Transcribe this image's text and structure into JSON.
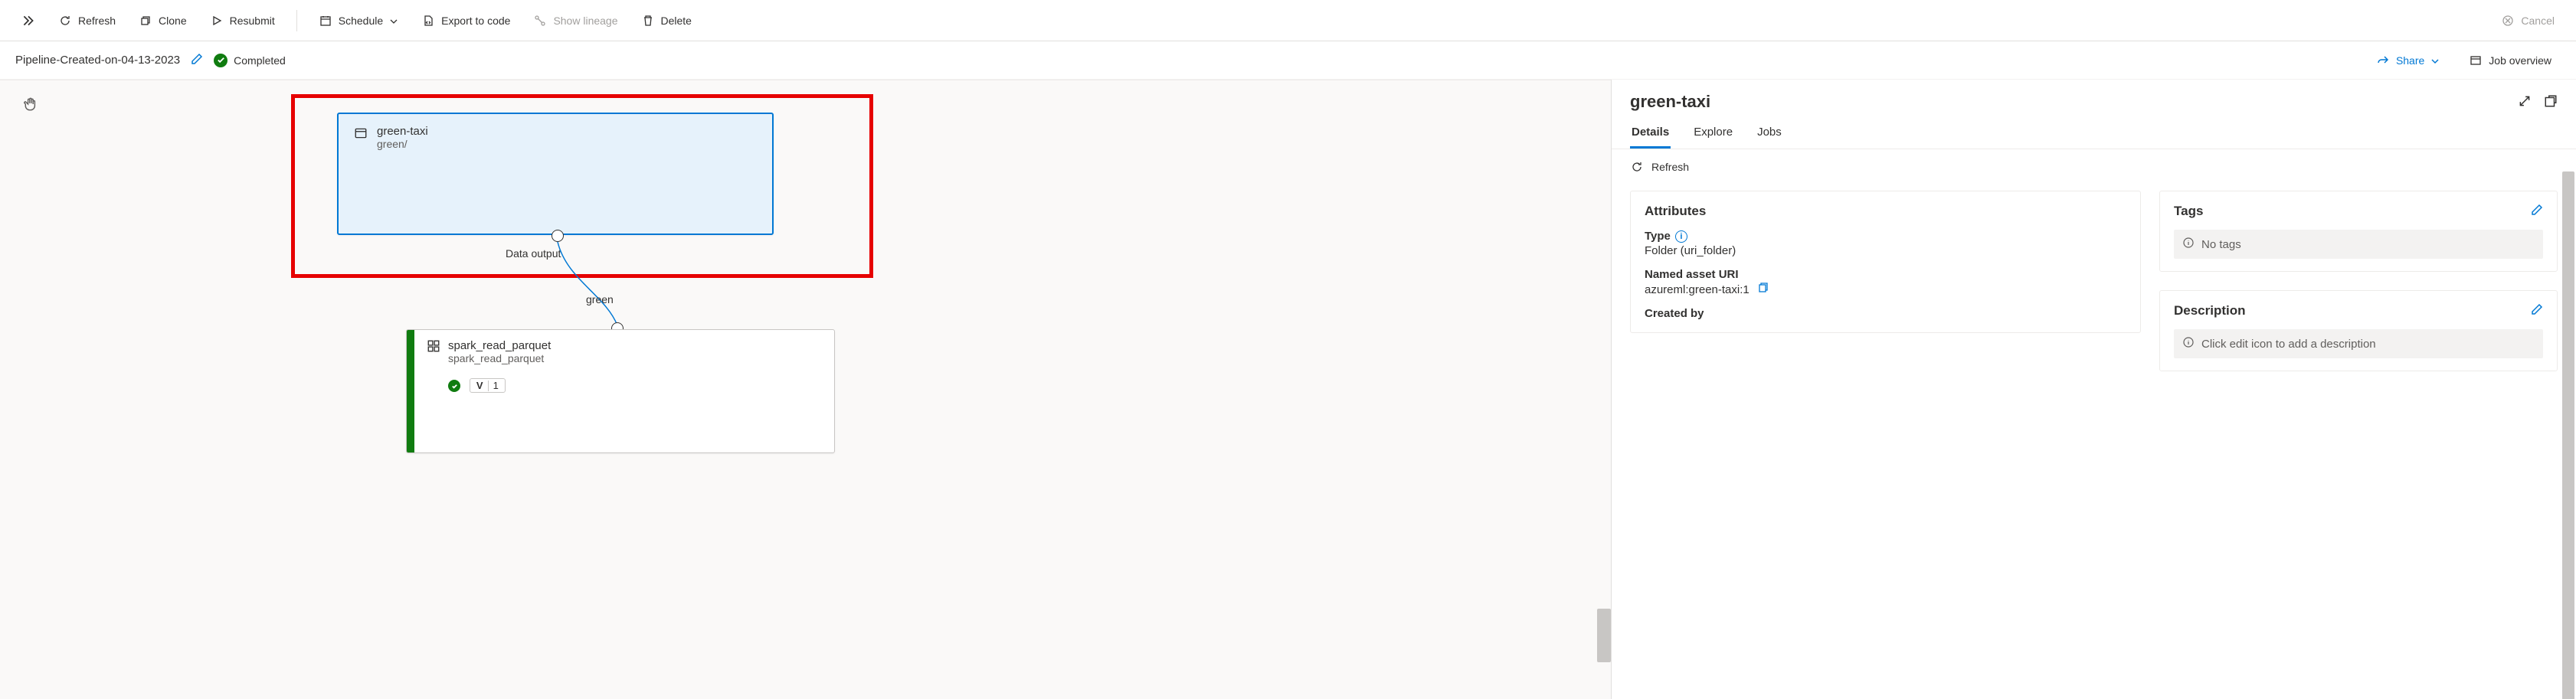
{
  "toolbar": {
    "refresh": "Refresh",
    "clone": "Clone",
    "resubmit": "Resubmit",
    "schedule": "Schedule",
    "export": "Export to code",
    "lineage": "Show lineage",
    "delete": "Delete",
    "cancel": "Cancel"
  },
  "pipeline": {
    "name": "Pipeline-Created-on-04-13-2023",
    "status": "Completed"
  },
  "infobar_actions": {
    "share": "Share",
    "overview": "Job overview"
  },
  "canvas": {
    "node1": {
      "title": "green-taxi",
      "sub": "green/",
      "output_label": "Data output"
    },
    "edge_label": "green",
    "node2": {
      "title": "spark_read_parquet",
      "sub": "spark_read_parquet",
      "v_label": "V",
      "v_num": "1"
    }
  },
  "side": {
    "title": "green-taxi",
    "tabs": {
      "details": "Details",
      "explore": "Explore",
      "jobs": "Jobs"
    },
    "refresh": "Refresh",
    "attributes": {
      "heading": "Attributes",
      "type_label": "Type",
      "type_value": "Folder (uri_folder)",
      "uri_label": "Named asset URI",
      "uri_value": "azureml:green-taxi:1",
      "created_label": "Created by"
    },
    "tags": {
      "heading": "Tags",
      "empty": "No tags"
    },
    "description": {
      "heading": "Description",
      "empty": "Click edit icon to add a description"
    }
  }
}
